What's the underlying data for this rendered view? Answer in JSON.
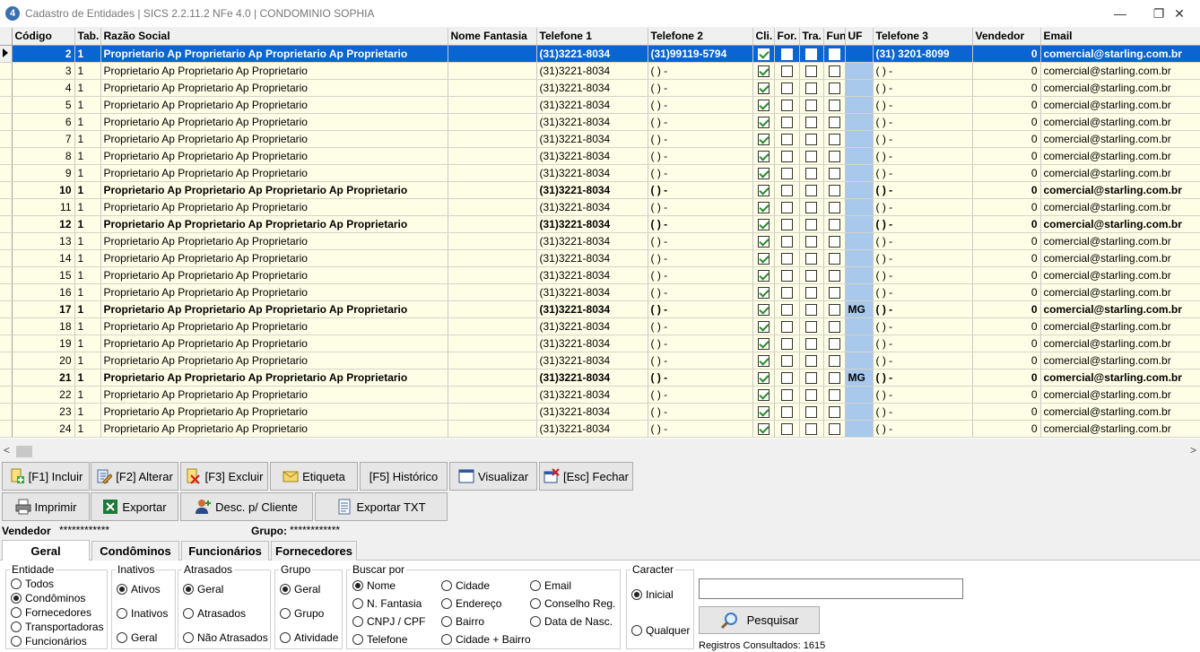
{
  "window": {
    "title": "Cadastro de Entidades | SICS 2.2.11.2 NFe 4.0 | CONDOMINIO SOPHIA",
    "app_icon_char": "4",
    "minimize_glyph": "—",
    "restore_glyph": "❐",
    "close_glyph": "✕"
  },
  "grid": {
    "columns": [
      "Código",
      "Tab.",
      "Razão Social",
      "Nome Fantasia",
      "Telefone 1",
      "Telefone 2",
      "Cli.",
      "For.",
      "Tra.",
      "Fun",
      "UF",
      "Telefone 3",
      "Vendedor",
      "Email"
    ],
    "rows": [
      {
        "codigo": "2",
        "tab": "1",
        "razao": "Proprietario Ap Proprietario Ap Proprietario Ap Proprietario",
        "fantasia": "",
        "tel1": "(31)3221-8034",
        "tel2": "(31)99119-5794",
        "cli": true,
        "for": false,
        "tra": false,
        "fun": false,
        "uf": "",
        "tel3": "(31) 3201-8099",
        "vendedor": "0",
        "email": "comercial@starling.com.br",
        "selected": true,
        "bold": true
      },
      {
        "codigo": "3",
        "tab": "1",
        "razao": "Proprietario Ap Proprietario Ap Proprietario",
        "fantasia": "",
        "tel1": "(31)3221-8034",
        "tel2": "(  )     -",
        "cli": true,
        "for": false,
        "tra": false,
        "fun": false,
        "uf": "",
        "tel3": "(  )     -",
        "vendedor": "0",
        "email": "comercial@starling.com.br",
        "selected": false,
        "bold": false
      },
      {
        "codigo": "4",
        "tab": "1",
        "razao": "Proprietario Ap Proprietario Ap Proprietario",
        "fantasia": "",
        "tel1": "(31)3221-8034",
        "tel2": "(  )     -",
        "cli": true,
        "for": false,
        "tra": false,
        "fun": false,
        "uf": "",
        "tel3": "(  )     -",
        "vendedor": "0",
        "email": "comercial@starling.com.br",
        "selected": false,
        "bold": false
      },
      {
        "codigo": "5",
        "tab": "1",
        "razao": "Proprietario Ap Proprietario Ap Proprietario",
        "fantasia": "",
        "tel1": "(31)3221-8034",
        "tel2": "(  )     -",
        "cli": true,
        "for": false,
        "tra": false,
        "fun": false,
        "uf": "",
        "tel3": "(  )     -",
        "vendedor": "0",
        "email": "comercial@starling.com.br",
        "selected": false,
        "bold": false
      },
      {
        "codigo": "6",
        "tab": "1",
        "razao": "Proprietario Ap Proprietario Ap Proprietario",
        "fantasia": "",
        "tel1": "(31)3221-8034",
        "tel2": "(  )     -",
        "cli": true,
        "for": false,
        "tra": false,
        "fun": false,
        "uf": "",
        "tel3": "(  )     -",
        "vendedor": "0",
        "email": "comercial@starling.com.br",
        "selected": false,
        "bold": false
      },
      {
        "codigo": "7",
        "tab": "1",
        "razao": "Proprietario Ap Proprietario Ap Proprietario",
        "fantasia": "",
        "tel1": "(31)3221-8034",
        "tel2": "(  )     -",
        "cli": true,
        "for": false,
        "tra": false,
        "fun": false,
        "uf": "",
        "tel3": "(  )     -",
        "vendedor": "0",
        "email": "comercial@starling.com.br",
        "selected": false,
        "bold": false
      },
      {
        "codigo": "8",
        "tab": "1",
        "razao": "Proprietario Ap Proprietario Ap Proprietario",
        "fantasia": "",
        "tel1": "(31)3221-8034",
        "tel2": "(  )     -",
        "cli": true,
        "for": false,
        "tra": false,
        "fun": false,
        "uf": "",
        "tel3": "(  )     -",
        "vendedor": "0",
        "email": "comercial@starling.com.br",
        "selected": false,
        "bold": false
      },
      {
        "codigo": "9",
        "tab": "1",
        "razao": "Proprietario Ap Proprietario Ap Proprietario",
        "fantasia": "",
        "tel1": "(31)3221-8034",
        "tel2": "(  )     -",
        "cli": true,
        "for": false,
        "tra": false,
        "fun": false,
        "uf": "",
        "tel3": "(  )     -",
        "vendedor": "0",
        "email": "comercial@starling.com.br",
        "selected": false,
        "bold": false
      },
      {
        "codigo": "10",
        "tab": "1",
        "razao": "Proprietario Ap Proprietario Ap Proprietario Ap Proprietario",
        "fantasia": "",
        "tel1": "(31)3221-8034",
        "tel2": "(  )     -",
        "cli": true,
        "for": false,
        "tra": false,
        "fun": false,
        "uf": "",
        "tel3": "(  )     -",
        "vendedor": "0",
        "email": "comercial@starling.com.br",
        "selected": false,
        "bold": true
      },
      {
        "codigo": "11",
        "tab": "1",
        "razao": "Proprietario Ap Proprietario Ap Proprietario",
        "fantasia": "",
        "tel1": "(31)3221-8034",
        "tel2": "(  )     -",
        "cli": true,
        "for": false,
        "tra": false,
        "fun": false,
        "uf": "",
        "tel3": "(  )     -",
        "vendedor": "0",
        "email": "comercial@starling.com.br",
        "selected": false,
        "bold": false
      },
      {
        "codigo": "12",
        "tab": "1",
        "razao": "Proprietario Ap Proprietario Ap Proprietario Ap Proprietario",
        "fantasia": "",
        "tel1": "(31)3221-8034",
        "tel2": "(  )     -",
        "cli": true,
        "for": false,
        "tra": false,
        "fun": false,
        "uf": "",
        "tel3": "(  )     -",
        "vendedor": "0",
        "email": "comercial@starling.com.br",
        "selected": false,
        "bold": true
      },
      {
        "codigo": "13",
        "tab": "1",
        "razao": "Proprietario Ap Proprietario Ap Proprietario",
        "fantasia": "",
        "tel1": "(31)3221-8034",
        "tel2": "(  )     -",
        "cli": true,
        "for": false,
        "tra": false,
        "fun": false,
        "uf": "",
        "tel3": "(  )     -",
        "vendedor": "0",
        "email": "comercial@starling.com.br",
        "selected": false,
        "bold": false
      },
      {
        "codigo": "14",
        "tab": "1",
        "razao": "Proprietario Ap Proprietario Ap Proprietario",
        "fantasia": "",
        "tel1": "(31)3221-8034",
        "tel2": "(  )     -",
        "cli": true,
        "for": false,
        "tra": false,
        "fun": false,
        "uf": "",
        "tel3": "(  )     -",
        "vendedor": "0",
        "email": "comercial@starling.com.br",
        "selected": false,
        "bold": false
      },
      {
        "codigo": "15",
        "tab": "1",
        "razao": "Proprietario Ap Proprietario Ap Proprietario",
        "fantasia": "",
        "tel1": "(31)3221-8034",
        "tel2": "(  )     -",
        "cli": true,
        "for": false,
        "tra": false,
        "fun": false,
        "uf": "",
        "tel3": "(  )     -",
        "vendedor": "0",
        "email": "comercial@starling.com.br",
        "selected": false,
        "bold": false
      },
      {
        "codigo": "16",
        "tab": "1",
        "razao": "Proprietario Ap Proprietario Ap Proprietario",
        "fantasia": "",
        "tel1": "(31)3221-8034",
        "tel2": "(  )     -",
        "cli": true,
        "for": false,
        "tra": false,
        "fun": false,
        "uf": "",
        "tel3": "(  )     -",
        "vendedor": "0",
        "email": "comercial@starling.com.br",
        "selected": false,
        "bold": false
      },
      {
        "codigo": "17",
        "tab": "1",
        "razao": "Proprietario Ap Proprietario Ap Proprietario Ap Proprietario",
        "fantasia": "",
        "tel1": "(31)3221-8034",
        "tel2": "(  )     -",
        "cli": true,
        "for": false,
        "tra": false,
        "fun": false,
        "uf": "MG",
        "tel3": "(  )     -",
        "vendedor": "0",
        "email": "comercial@starling.com.br",
        "selected": false,
        "bold": true
      },
      {
        "codigo": "18",
        "tab": "1",
        "razao": "Proprietario Ap Proprietario Ap Proprietario",
        "fantasia": "",
        "tel1": "(31)3221-8034",
        "tel2": "(  )     -",
        "cli": true,
        "for": false,
        "tra": false,
        "fun": false,
        "uf": "",
        "tel3": "(  )     -",
        "vendedor": "0",
        "email": "comercial@starling.com.br",
        "selected": false,
        "bold": false
      },
      {
        "codigo": "19",
        "tab": "1",
        "razao": "Proprietario Ap Proprietario Ap Proprietario",
        "fantasia": "",
        "tel1": "(31)3221-8034",
        "tel2": "(  )     -",
        "cli": true,
        "for": false,
        "tra": false,
        "fun": false,
        "uf": "",
        "tel3": "(  )     -",
        "vendedor": "0",
        "email": "comercial@starling.com.br",
        "selected": false,
        "bold": false
      },
      {
        "codigo": "20",
        "tab": "1",
        "razao": "Proprietario Ap Proprietario Ap Proprietario",
        "fantasia": "",
        "tel1": "(31)3221-8034",
        "tel2": "(  )     -",
        "cli": true,
        "for": false,
        "tra": false,
        "fun": false,
        "uf": "",
        "tel3": "(  )     -",
        "vendedor": "0",
        "email": "comercial@starling.com.br",
        "selected": false,
        "bold": false
      },
      {
        "codigo": "21",
        "tab": "1",
        "razao": "Proprietario Ap Proprietario Ap Proprietario Ap Proprietario",
        "fantasia": "",
        "tel1": "(31)3221-8034",
        "tel2": "(  )     -",
        "cli": true,
        "for": false,
        "tra": false,
        "fun": false,
        "uf": "MG",
        "tel3": "(  )     -",
        "vendedor": "0",
        "email": "comercial@starling.com.br",
        "selected": false,
        "bold": true
      },
      {
        "codigo": "22",
        "tab": "1",
        "razao": "Proprietario Ap Proprietario Ap Proprietario",
        "fantasia": "",
        "tel1": "(31)3221-8034",
        "tel2": "(  )     -",
        "cli": true,
        "for": false,
        "tra": false,
        "fun": false,
        "uf": "",
        "tel3": "(  )     -",
        "vendedor": "0",
        "email": "comercial@starling.com.br",
        "selected": false,
        "bold": false
      },
      {
        "codigo": "23",
        "tab": "1",
        "razao": "Proprietario Ap Proprietario Ap Proprietario",
        "fantasia": "",
        "tel1": "(31)3221-8034",
        "tel2": "(  )     -",
        "cli": true,
        "for": false,
        "tra": false,
        "fun": false,
        "uf": "",
        "tel3": "(  )     -",
        "vendedor": "0",
        "email": "comercial@starling.com.br",
        "selected": false,
        "bold": false
      },
      {
        "codigo": "24",
        "tab": "1",
        "razao": "Proprietario Ap Proprietario Ap Proprietario",
        "fantasia": "",
        "tel1": "(31)3221-8034",
        "tel2": "(  )     -",
        "cli": true,
        "for": false,
        "tra": false,
        "fun": false,
        "uf": "",
        "tel3": "(  )     -",
        "vendedor": "0",
        "email": "comercial@starling.com.br",
        "selected": false,
        "bold": false
      }
    ]
  },
  "scroll": {
    "left_glyph": "<",
    "right_glyph": ">"
  },
  "toolbar": {
    "incluir": "[F1] Incluir",
    "alterar": "[F2] Alterar",
    "excluir": "[F3] Excluir",
    "etiqueta": "Etiqueta",
    "historico": "[F5] Histórico",
    "visualizar": "Visualizar",
    "fechar": "[Esc] Fechar",
    "imprimir": "Imprimir",
    "exportar": "Exportar",
    "desc_cliente": "Desc. p/ Cliente",
    "exportar_txt": "Exportar TXT"
  },
  "filters": {
    "vendedor_label": "Vendedor",
    "vendedor_value": "************",
    "grupo_label": "Grupo:",
    "grupo_value": "************"
  },
  "tabs": [
    "Geral",
    "Condôminos",
    "Funcionários",
    "Fornecedores"
  ],
  "groups": {
    "entidade": {
      "legend": "Entidade",
      "options": [
        "Todos",
        "Condôminos",
        "Fornecedores",
        "Transportadoras",
        "Funcionários"
      ],
      "selected": 1
    },
    "inativos": {
      "legend": "Inativos",
      "options": [
        "Ativos",
        "Inativos",
        "Geral"
      ],
      "selected": 0
    },
    "atrasados": {
      "legend": "Atrasados",
      "options": [
        "Geral",
        "Atrasados",
        "Não Atrasados"
      ],
      "selected": 0
    },
    "grupo": {
      "legend": "Grupo",
      "options": [
        "Geral",
        "Grupo",
        "Atividade"
      ],
      "selected": 0
    },
    "buscar": {
      "legend": "Buscar por",
      "options": [
        "Nome",
        "N. Fantasia",
        "CNPJ / CPF",
        "Telefone",
        "Cidade",
        "Endereço",
        "Bairro",
        "Cidade + Bairro",
        "Email",
        "Conselho Reg.",
        "Data de Nasc."
      ],
      "selected": 0
    },
    "caracter": {
      "legend": "Caracter",
      "options": [
        "Inicial",
        "Qualquer"
      ],
      "selected": 0
    }
  },
  "search": {
    "value": "",
    "button": "Pesquisar"
  },
  "status": {
    "registros": "Registros Consultados: 1615"
  }
}
